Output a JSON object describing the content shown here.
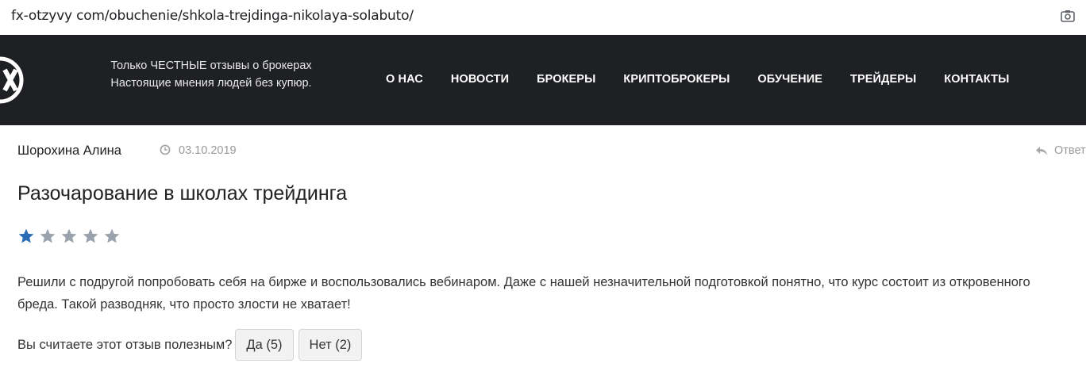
{
  "browser": {
    "url": "fx-otzyvy com/obuchenie/shkola-trejdinga-nikolaya-solabuto/"
  },
  "header": {
    "tagline_line1": "Только ЧЕСТНЫЕ отзывы о брокерах",
    "tagline_line2": "Настоящие мнения людей без купюр.",
    "nav": [
      "О НАС",
      "НОВОСТИ",
      "БРОКЕРЫ",
      "КРИПТОБРОКЕРЫ",
      "ОБУЧЕНИЕ",
      "ТРЕЙДЕРЫ",
      "КОНТАКТЫ"
    ]
  },
  "review": {
    "author": "Шорохина Алина",
    "date": "03.10.2019",
    "reply_label": "Ответ",
    "title": "Разочарование в школах трейдинга",
    "rating": 1,
    "rating_max": 5,
    "text": "Решили с подругой попробовать себя на бирже и воспользовались вебинаром. Даже с нашей незначительной подготовкой понятно, что курс состоит из откровенного бреда. Такой разводняк, что просто злости не хватает!",
    "helpful_question": "Вы считаете этот отзыв полезным?",
    "yes_label": "Да (5)",
    "no_label": "Нет (2)"
  },
  "colors": {
    "header_bg": "#1f2023",
    "star_active": "#2a6bb5",
    "star_inactive": "#9aa3ad"
  }
}
